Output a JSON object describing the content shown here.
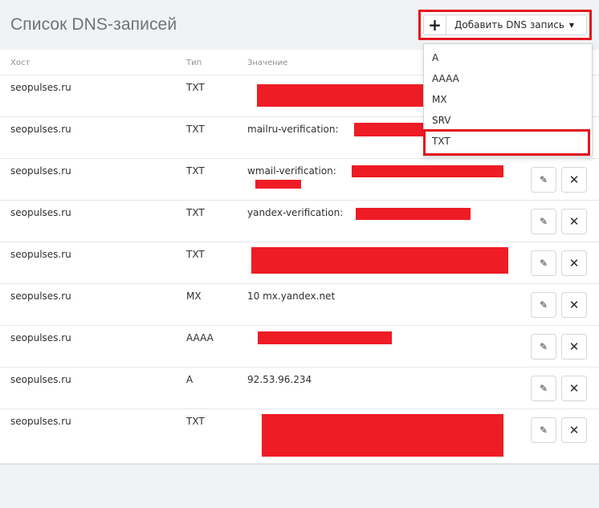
{
  "header": {
    "title": "Список DNS-записей",
    "add_button_label": "Добавить DNS запись"
  },
  "table": {
    "columns": [
      "Хост",
      "Тип",
      "Значение"
    ],
    "rows": [
      {
        "host": "seopulses.ru",
        "type": "TXT",
        "value": ""
      },
      {
        "host": "seopulses.ru",
        "type": "TXT",
        "value": "mailru-verification:"
      },
      {
        "host": "seopulses.ru",
        "type": "TXT",
        "value": "wmail-verification:"
      },
      {
        "host": "seopulses.ru",
        "type": "TXT",
        "value": "yandex-verification:"
      },
      {
        "host": "seopulses.ru",
        "type": "TXT",
        "value": ""
      },
      {
        "host": "seopulses.ru",
        "type": "MX",
        "value": "10 mx.yandex.net"
      },
      {
        "host": "seopulses.ru",
        "type": "AAAA",
        "value": ""
      },
      {
        "host": "seopulses.ru",
        "type": "A",
        "value": "92.53.96.234"
      },
      {
        "host": "seopulses.ru",
        "type": "TXT",
        "value": ""
      }
    ]
  },
  "dropdown": {
    "options": [
      "A",
      "AAAA",
      "MX",
      "SRV",
      "TXT"
    ],
    "highlighted": "TXT"
  },
  "colors": {
    "highlight_border": "#e3141f",
    "redaction": "#ee1c25"
  },
  "icons": {
    "add": "plus-icon",
    "caret": "caret-down-icon",
    "edit": "pencil-icon",
    "delete": "close-icon"
  }
}
